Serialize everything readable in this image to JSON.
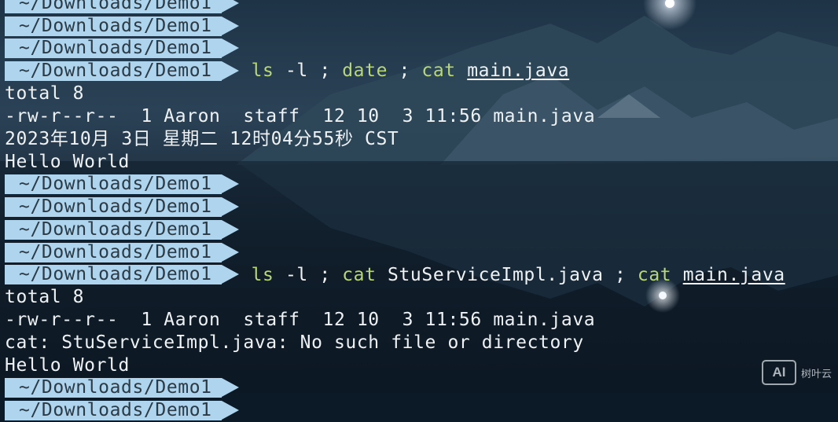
{
  "terminal": {
    "prompt": "~/Downloads/Demo1",
    "cmd1": {
      "ls": "ls",
      "flag": "-l",
      "sep": ";",
      "date": "date",
      "cat": "cat",
      "file": "main.java"
    },
    "out1": {
      "total": "total 8",
      "listing": "-rw-r--r--  1 Aaron  staff  12 10  3 11:56 main.java",
      "date_output": "2023年10月 3日 星期二 12时04分55秒 CST",
      "hello": "Hello World"
    },
    "cmd2": {
      "ls": "ls",
      "flag": "-l",
      "sep1": ";",
      "cat1": "cat",
      "file1": "StuServiceImpl.java",
      "sep2": ";",
      "cat2": "cat",
      "file2": "main.java"
    },
    "out2": {
      "total": "total 8",
      "listing": "-rw-r--r--  1 Aaron  staff  12 10  3 11:56 main.java",
      "error": "cat: StuServiceImpl.java: No such file or directory",
      "hello": "Hello World"
    }
  },
  "watermark": {
    "badge": "AI",
    "text": "树叶云"
  },
  "colors": {
    "prompt_bg": "#aed4ee",
    "prompt_text": "#2b3a44",
    "command": "#b8d67a",
    "text": "#eef2f4"
  }
}
